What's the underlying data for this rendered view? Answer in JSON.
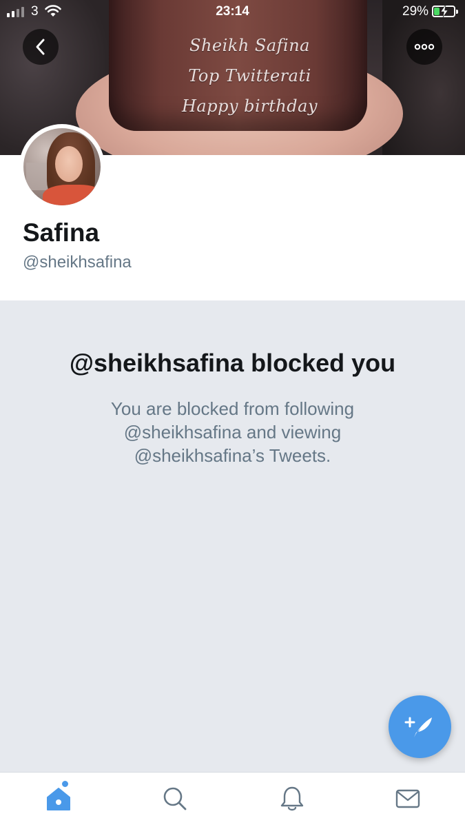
{
  "status_bar": {
    "carrier": "3",
    "time": "23:14",
    "battery_percent": "29%",
    "battery_level": 0.29,
    "signal_bars": 2,
    "charging": true
  },
  "banner": {
    "engraving_lines": [
      "Sheikh Safina",
      "Top Twitterati",
      "Happy birthday"
    ]
  },
  "header": {
    "back_icon": "chevron-left-icon",
    "more_icon": "ellipsis-icon"
  },
  "profile": {
    "name": "Safina",
    "handle": "@sheikhsafina"
  },
  "blocked": {
    "title": "@sheikhsafina blocked you",
    "message_line1": "You are blocked from following",
    "message_line2": "@sheikhsafina and viewing",
    "message_line3": "@sheikhsafina’s Tweets."
  },
  "fab": {
    "icon": "compose-tweet-icon"
  },
  "tabbar": {
    "tabs": [
      {
        "name": "home",
        "icon": "home-icon",
        "active": true
      },
      {
        "name": "search",
        "icon": "search-icon",
        "active": false
      },
      {
        "name": "notifications",
        "icon": "bell-icon",
        "active": false
      },
      {
        "name": "messages",
        "icon": "envelope-icon",
        "active": false
      }
    ]
  },
  "colors": {
    "accent": "#4a99e9",
    "blocked_background": "#e6e9ee",
    "secondary_text": "#657786",
    "primary_text": "#14171a"
  }
}
